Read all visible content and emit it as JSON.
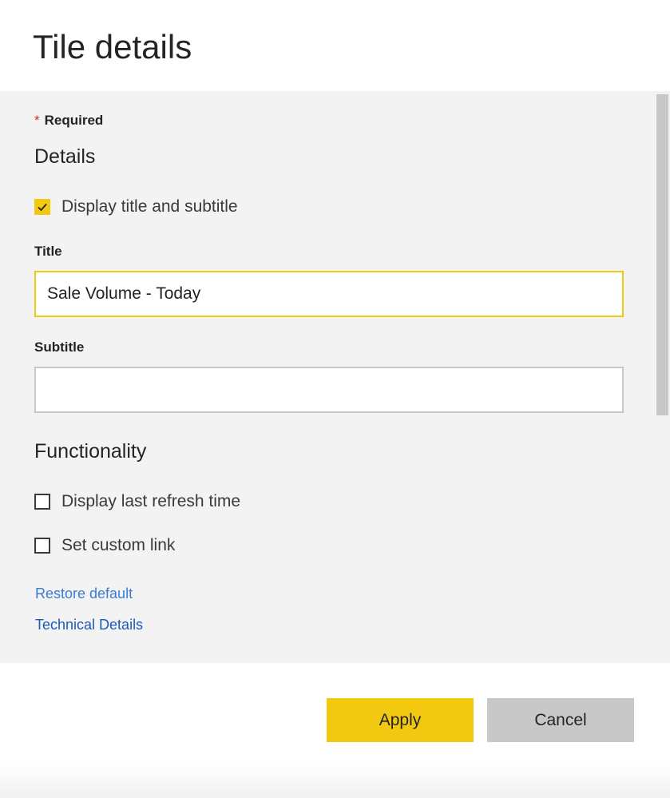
{
  "header": {
    "title": "Tile details"
  },
  "form": {
    "required_star": "*",
    "required_label": "Required",
    "details_heading": "Details",
    "display_title_checkbox": {
      "label": "Display title and subtitle",
      "checked": true
    },
    "title_field": {
      "label": "Title",
      "value": "Sale Volume - Today"
    },
    "subtitle_field": {
      "label": "Subtitle",
      "value": ""
    },
    "functionality_heading": "Functionality",
    "refresh_checkbox": {
      "label": "Display last refresh time",
      "checked": false
    },
    "custom_link_checkbox": {
      "label": "Set custom link",
      "checked": false
    },
    "restore_link": "Restore default",
    "technical_link": "Technical Details"
  },
  "footer": {
    "apply_label": "Apply",
    "cancel_label": "Cancel"
  },
  "colors": {
    "accent": "#f2c811",
    "panel_bg": "#f3f3f3",
    "link": "#3a7bd5",
    "cancel_bg": "#c8c8c8",
    "required_star": "#e0262f"
  }
}
